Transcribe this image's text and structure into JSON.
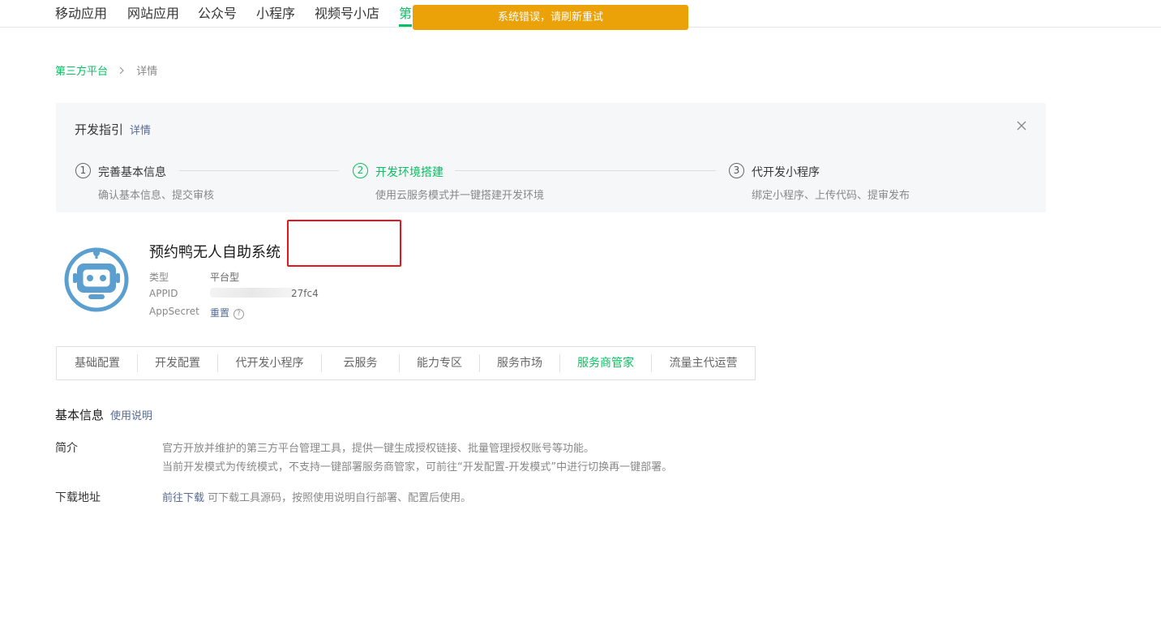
{
  "topnav": {
    "tabs": [
      "移动应用",
      "网站应用",
      "公众号",
      "小程序",
      "视频号小店",
      "第"
    ],
    "active_index": 5
  },
  "toast": {
    "message": "系统错误，请刷新重试"
  },
  "breadcrumb": {
    "parent": "第三方平台",
    "separator": ">",
    "current": "详情"
  },
  "guide": {
    "title": "开发指引",
    "more_link": "详情",
    "steps": [
      {
        "num": "1",
        "name": "完善基本信息",
        "desc": "确认基本信息、提交审核"
      },
      {
        "num": "2",
        "name": "开发环境搭建",
        "desc": "使用云服务模式并一键搭建开发环境"
      },
      {
        "num": "3",
        "name": "代开发小程序",
        "desc": "绑定小程序、上传代码、提审发布"
      }
    ],
    "active_step": 1,
    "close_icon": "close-icon"
  },
  "app": {
    "name": "预约鸭无人自助系统",
    "type_label": "类型",
    "type_value": "平台型",
    "appid_label": "APPID",
    "appid_value": "27fc4",
    "secret_label": "AppSecret",
    "secret_action": "重置",
    "secret_help_icon": "question-circle-icon",
    "avatar_icon": "robot-avatar-icon"
  },
  "tabs": {
    "items": [
      "基础配置",
      "开发配置",
      "代开发小程序",
      "云服务",
      "能力专区",
      "服务市场",
      "服务商管家",
      "流量主代运营"
    ],
    "active_index": 6
  },
  "basic_info": {
    "title": "基本信息",
    "help_link": "使用说明",
    "intro_label": "简介",
    "intro_line1": "官方开放并维护的第三方平台管理工具，提供一键生成授权链接、批量管理授权账号等功能。",
    "intro_line2": "当前开发模式为传统模式，不支持一键部署服务商管家，可前往“开发配置-开发模式”中进行切换再一键部署。",
    "download_label": "下载地址",
    "download_link": "前往下载",
    "download_text": " 可下载工具源码，按照使用说明自行部署、配置后使用。"
  },
  "colors": {
    "brand": "#07c160",
    "link": "#576b95",
    "toast": "#eba108",
    "highlight": "#e5161c"
  }
}
